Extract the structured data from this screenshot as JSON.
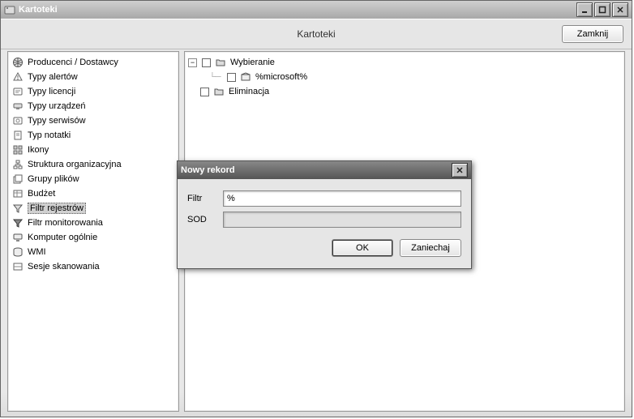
{
  "window": {
    "title": "Kartoteki"
  },
  "toolbar": {
    "title": "Kartoteki",
    "close_btn": "Zamknij"
  },
  "sidebar": {
    "items": [
      {
        "label": "Producenci / Dostawcy"
      },
      {
        "label": "Typy alertów"
      },
      {
        "label": "Typy licencji"
      },
      {
        "label": "Typy urządzeń"
      },
      {
        "label": "Typy serwisów"
      },
      {
        "label": "Typ notatki"
      },
      {
        "label": "Ikony"
      },
      {
        "label": "Struktura organizacyjna"
      },
      {
        "label": "Grupy plików"
      },
      {
        "label": "Budżet"
      },
      {
        "label": "Filtr rejestrów"
      },
      {
        "label": "Filtr monitorowania"
      },
      {
        "label": "Komputer ogólnie"
      },
      {
        "label": "WMI"
      },
      {
        "label": "Sesje skanowania"
      }
    ],
    "selected_index": 10
  },
  "rtree": {
    "root": {
      "label": "Wybieranie",
      "children": [
        {
          "label": "%microsoft%"
        }
      ]
    },
    "sibling": {
      "label": "Eliminacja"
    }
  },
  "dialog": {
    "title": "Nowy rekord",
    "fields": {
      "filter_label": "Filtr",
      "filter_value": "%",
      "sod_label": "SOD",
      "sod_value": ""
    },
    "ok": "OK",
    "cancel": "Zaniechaj"
  }
}
